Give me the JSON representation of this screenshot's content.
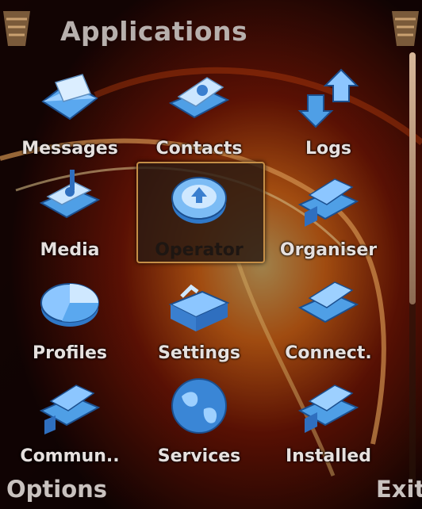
{
  "title": "Applications",
  "softkeys": {
    "left": "Options",
    "right": "Exit"
  },
  "selected_index": 4,
  "scroll": {
    "position_fraction": 0.0,
    "visible_fraction": 0.58
  },
  "items": [
    {
      "label": "Messages",
      "icon": "envelope-icon"
    },
    {
      "label": "Contacts",
      "icon": "contacts-folder-icon"
    },
    {
      "label": "Logs",
      "icon": "logs-arrows-icon"
    },
    {
      "label": "Media",
      "icon": "media-folder-icon"
    },
    {
      "label": "Operator",
      "icon": "operator-disc-icon"
    },
    {
      "label": "Organiser",
      "icon": "organiser-folder-icon"
    },
    {
      "label": "Profiles",
      "icon": "profiles-pie-icon"
    },
    {
      "label": "Settings",
      "icon": "settings-toolbox-icon"
    },
    {
      "label": "Connect.",
      "icon": "connectivity-folder-icon"
    },
    {
      "label": "Commun..",
      "icon": "communication-folder-icon"
    },
    {
      "label": "Services",
      "icon": "services-globe-icon"
    },
    {
      "label": "Installed",
      "icon": "installed-folder-icon"
    }
  ],
  "colors": {
    "accent": "#c58e46",
    "icon_blue": "#4f9fe6",
    "wallpaper_glow": "#ff7a1a"
  }
}
